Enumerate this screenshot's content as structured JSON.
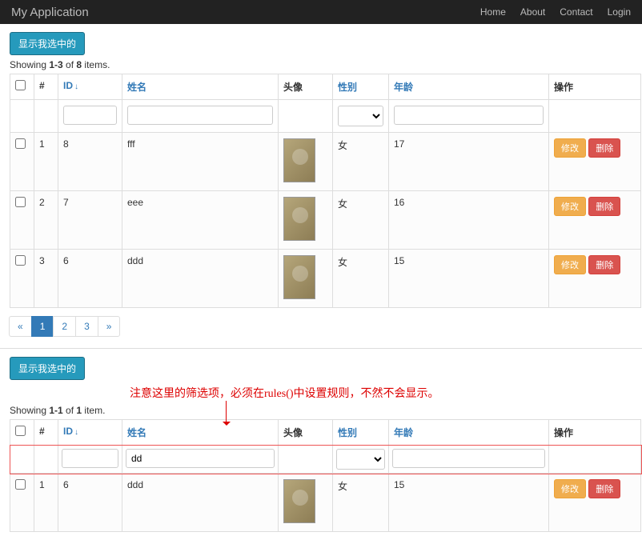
{
  "navbar": {
    "brand": "My Application",
    "links": {
      "home": "Home",
      "about": "About",
      "contact": "Contact",
      "login": "Login"
    }
  },
  "grid1": {
    "show_selected_label": "显示我选中的",
    "summary_prefix": "Showing ",
    "summary_range": "1-3",
    "summary_mid": " of ",
    "summary_total": "8",
    "summary_suffix": " items.",
    "cols": {
      "index": "#",
      "id": "ID",
      "name": "姓名",
      "avatar": "头像",
      "gender": "性别",
      "age": "年龄",
      "ops": "操作"
    },
    "filters": {
      "id": "",
      "name": "",
      "gender": "",
      "age": ""
    },
    "rows": [
      {
        "idx": "1",
        "id": "8",
        "name": "fff",
        "gender": "女",
        "age": "17"
      },
      {
        "idx": "2",
        "id": "7",
        "name": "eee",
        "gender": "女",
        "age": "16"
      },
      {
        "idx": "3",
        "id": "6",
        "name": "ddd",
        "gender": "女",
        "age": "15"
      }
    ],
    "row_actions": {
      "edit": "修改",
      "delete": "删除"
    },
    "pagination": {
      "prev": "«",
      "pages": [
        "1",
        "2",
        "3"
      ],
      "next": "»",
      "active": "1"
    }
  },
  "annotation_text": "注意这里的筛选项，必须在rules()中设置规则，不然不会显示。",
  "grid2": {
    "show_selected_label": "显示我选中的",
    "summary_prefix": "Showing ",
    "summary_range": "1-1",
    "summary_mid": " of ",
    "summary_total": "1",
    "summary_suffix": " item.",
    "cols": {
      "index": "#",
      "id": "ID",
      "name": "姓名",
      "avatar": "头像",
      "gender": "性别",
      "age": "年龄",
      "ops": "操作"
    },
    "filters": {
      "id": "",
      "name": "dd",
      "gender": "",
      "age": ""
    },
    "rows": [
      {
        "idx": "1",
        "id": "6",
        "name": "ddd",
        "gender": "女",
        "age": "15"
      }
    ],
    "row_actions": {
      "edit": "修改",
      "delete": "删除"
    }
  }
}
